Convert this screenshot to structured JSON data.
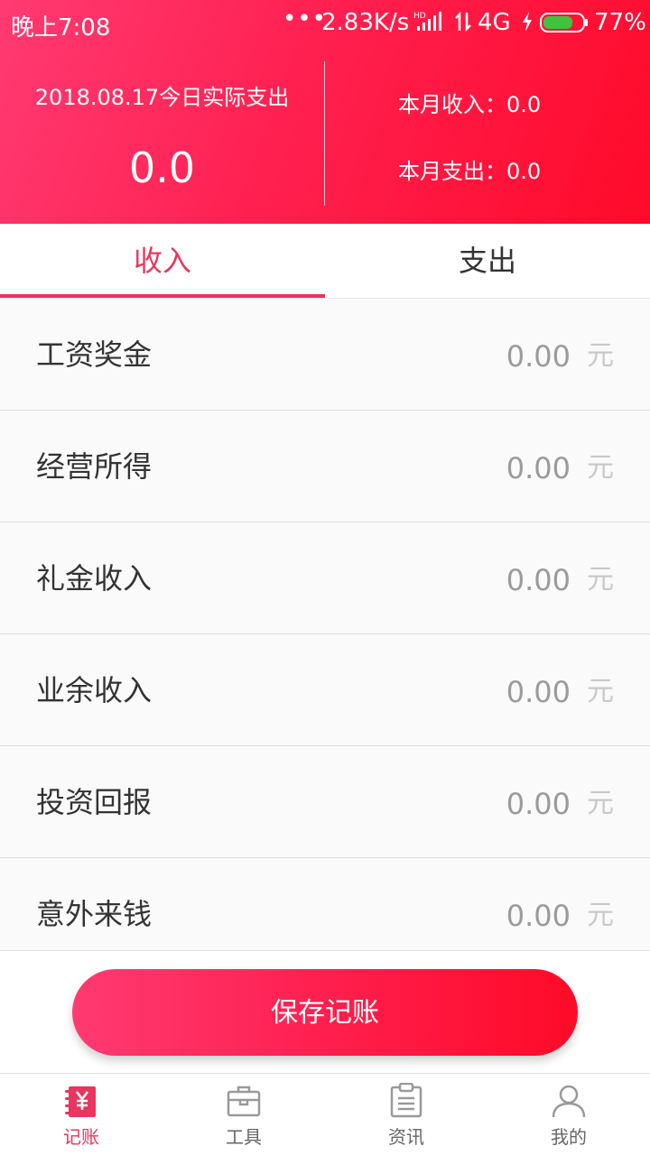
{
  "status_bar": {
    "time": "晚上7:08",
    "dots": "•••",
    "speed": "2.83K/s",
    "network": "4G",
    "battery_percent": "77%",
    "battery_level": 0.77,
    "signal_icon": "hd-signal-icon",
    "battery_color": "#3cc43c"
  },
  "summary": {
    "date_label": "2018.08.17今日实际支出",
    "today_amount": "0.0",
    "month_income": "本月收入：0.0",
    "month_expense": "本月支出：0.0"
  },
  "tabs": {
    "income": "收入",
    "expense": "支出"
  },
  "items": [
    {
      "label": "工资奖金",
      "value": "0.00",
      "unit": "元"
    },
    {
      "label": "经营所得",
      "value": "0.00",
      "unit": "元"
    },
    {
      "label": "礼金收入",
      "value": "0.00",
      "unit": "元"
    },
    {
      "label": "业余收入",
      "value": "0.00",
      "unit": "元"
    },
    {
      "label": "投资回报",
      "value": "0.00",
      "unit": "元"
    },
    {
      "label": "意外来钱",
      "value": "0.00",
      "unit": "元"
    }
  ],
  "save_label": "保存记账",
  "nav": [
    {
      "label": "记账",
      "icon": "ledger-icon"
    },
    {
      "label": "工具",
      "icon": "toolbox-icon"
    },
    {
      "label": "资讯",
      "icon": "clipboard-icon"
    },
    {
      "label": "我的",
      "icon": "person-icon"
    }
  ],
  "colors": {
    "accent": "#e8365e",
    "header_start": "#ff3a72",
    "header_end": "#ff0a2a"
  }
}
